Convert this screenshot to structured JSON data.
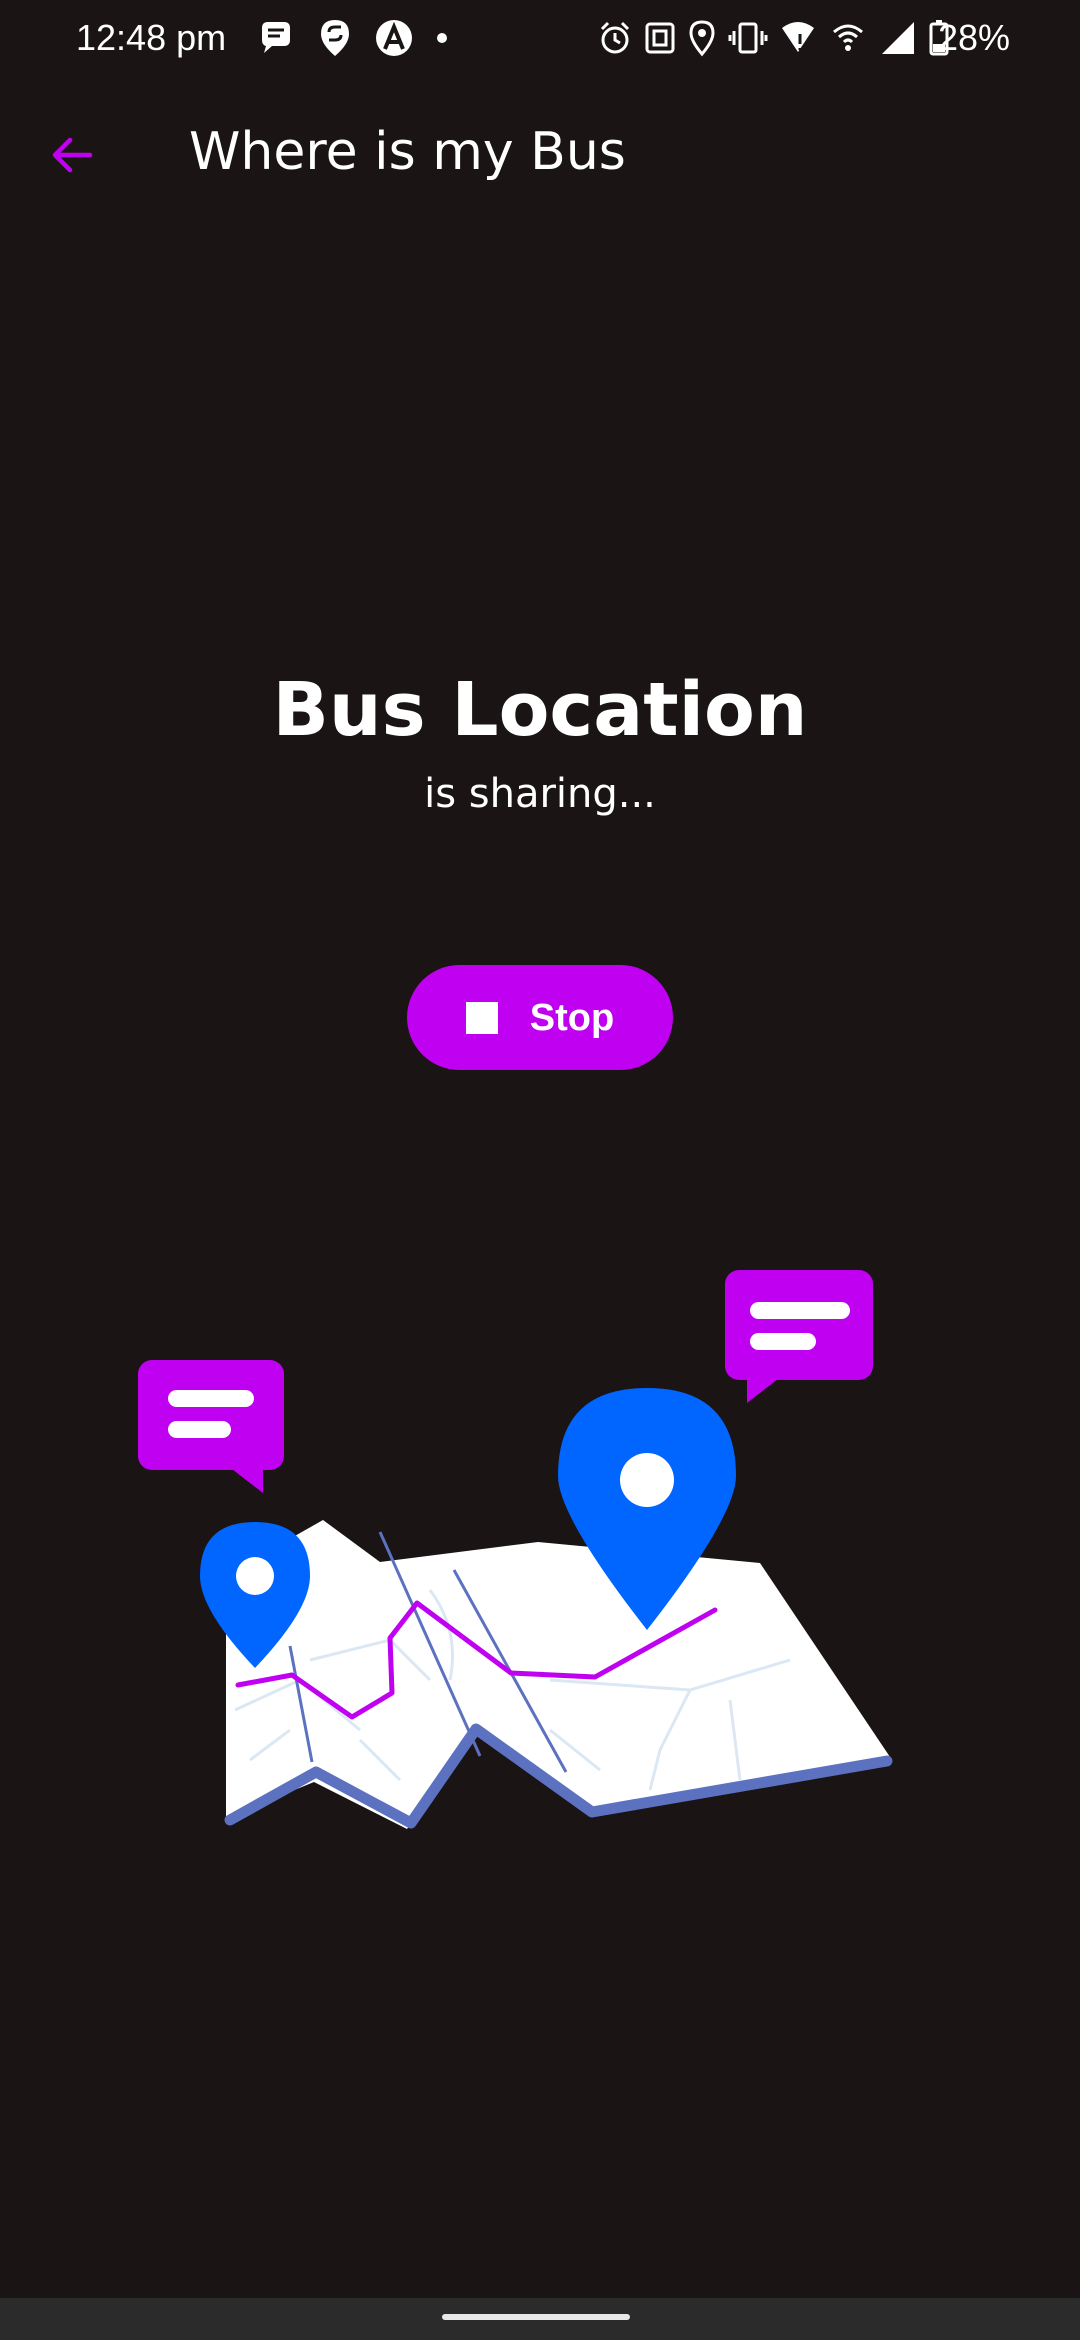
{
  "status_bar": {
    "time": "12:48 pm",
    "battery_percent": "28%",
    "left_icons": [
      "messaging-icon",
      "swiggy-icon",
      "arc-icon",
      "dot-icon"
    ],
    "right_icons": [
      "alarm-icon",
      "nfc-icon",
      "location-icon",
      "vibrate-icon",
      "wifi-icon",
      "hotspot-icon",
      "cellular-signal-icon",
      "battery-icon"
    ]
  },
  "app_bar": {
    "title": "Where is my Bus",
    "back_icon": "arrow-back-icon"
  },
  "main": {
    "heading": "Bus Location",
    "subheading": "is sharing...",
    "stop_button": {
      "label": "Stop",
      "icon": "stop-icon"
    }
  },
  "illustration": {
    "description_icon": "map-location-illustration"
  },
  "colors": {
    "background": "#1a1414",
    "accent": "#c000f0",
    "pin_blue": "#0066ff",
    "map_edge": "#5c72c0",
    "text": "#ffffff"
  }
}
